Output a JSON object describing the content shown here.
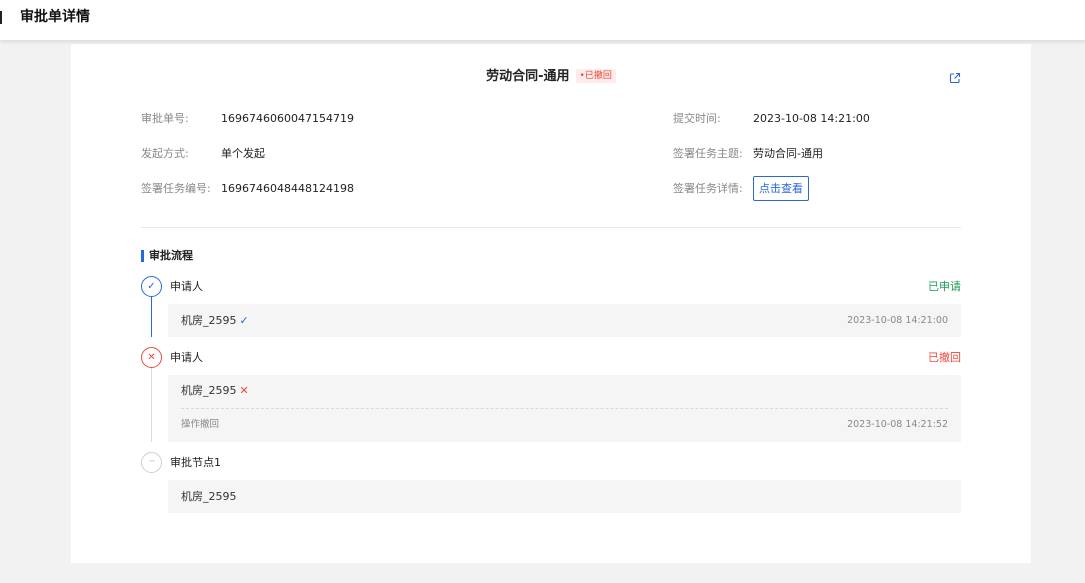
{
  "page": {
    "title": "审批单详情"
  },
  "header": {
    "title": "劳动合同-通用",
    "status": "•已撤回",
    "status_color": "#e8493a",
    "external_icon": "external-link-icon"
  },
  "info": {
    "approval_no_label": "审批单号:",
    "approval_no": "1696746060047154719",
    "submit_time_label": "提交时间:",
    "submit_time": "2023-10-08 14:21:00",
    "start_mode_label": "发起方式:",
    "start_mode": "单个发起",
    "task_subject_label": "签署任务主题:",
    "task_subject": "劳动合同-通用",
    "task_no_label": "签署任务编号:",
    "task_no": "1696746048448124198",
    "task_detail_label": "签署任务详情:",
    "task_detail_button": "点击查看"
  },
  "flow": {
    "title": "审批流程",
    "accent_color": "#2a67d9",
    "nodes": [
      {
        "icon": "check-icon",
        "label": "申请人",
        "status": "已申请",
        "status_color": "#1a9c58",
        "person": "机房_2595",
        "person_icon": "check-icon",
        "time": "2023-10-08 14:21:00"
      },
      {
        "icon": "close-icon",
        "label": "申请人",
        "status": "已撤回",
        "status_color": "#e8493a",
        "person": "机房_2595",
        "person_icon": "close-icon",
        "note": "操作撤回",
        "time": "2023-10-08 14:21:52"
      },
      {
        "icon": "ellipsis-icon",
        "label": "审批节点1",
        "person": "机房_2595"
      }
    ]
  }
}
